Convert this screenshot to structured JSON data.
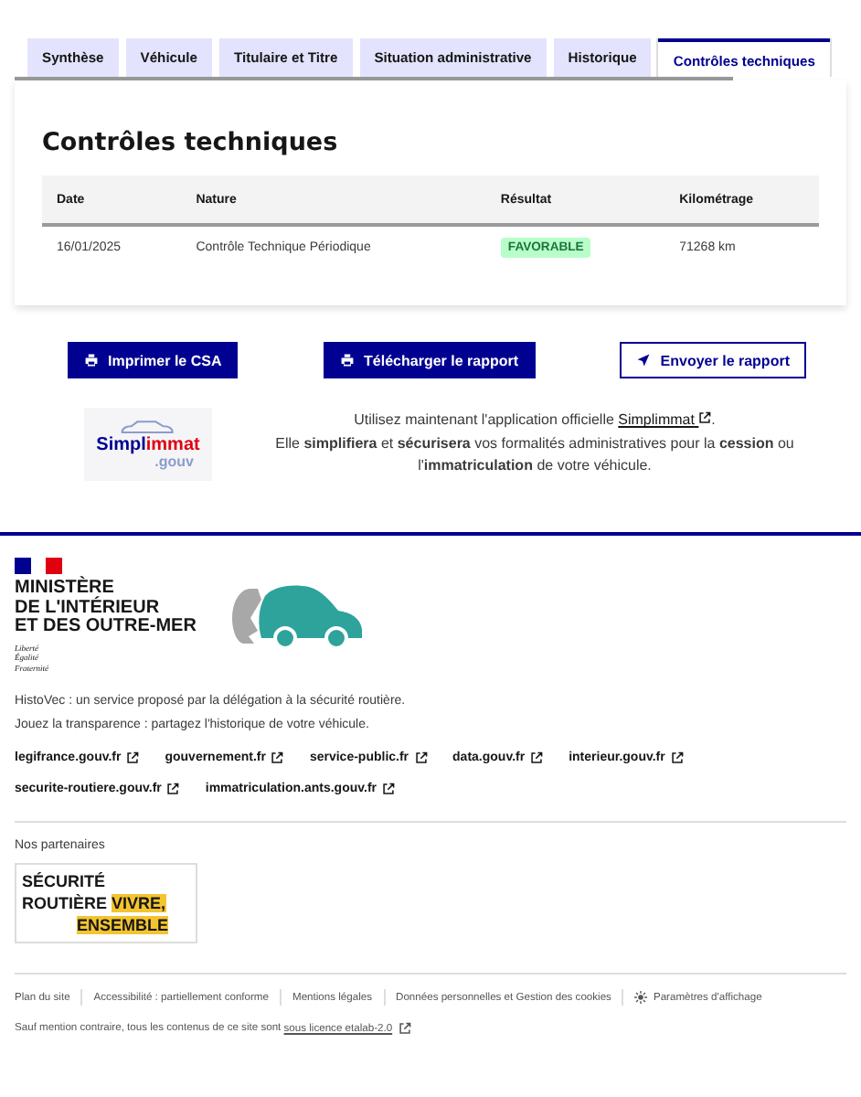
{
  "tabs": [
    {
      "label": "Synthèse",
      "selected": false
    },
    {
      "label": "Véhicule",
      "selected": false
    },
    {
      "label": "Titulaire et Titre",
      "selected": false
    },
    {
      "label": "Situation administrative",
      "selected": false
    },
    {
      "label": "Historique",
      "selected": false
    },
    {
      "label": "Contrôles techniques",
      "selected": true
    }
  ],
  "panel": {
    "title": "Contrôles techniques",
    "table": {
      "columns": [
        "Date",
        "Nature",
        "Résultat",
        "Kilométrage"
      ],
      "rows": [
        {
          "date": "16/01/2025",
          "nature": "Contrôle Technique Périodique",
          "result": {
            "text": "FAVORABLE",
            "kind": "success"
          },
          "mileage": "71268 km"
        }
      ]
    }
  },
  "buttons": [
    {
      "label": "Imprimer le CSA",
      "kind": "primary"
    },
    {
      "label": "Télécharger le rapport",
      "kind": "primary"
    },
    {
      "label": "Envoyer le rapport",
      "kind": "secondary"
    }
  ],
  "promo": {
    "logo": {
      "part_1": "Simpl",
      "part_2": "immat",
      "part_3": ".gouv"
    },
    "intro": "Utilisez maintenant l'application officielle",
    "link": "Simplimmat",
    "intro_end": ".",
    "body": "Elle **simplifiera** et **sécurisera** vos formalités administratives pour la **cession** ou l'**immatriculation** de votre véhicule."
  },
  "footer": {
    "ministry": [
      "MINISTÈRE",
      "DE L'INTÉRIEUR",
      "ET DES OUTRE-MER"
    ],
    "motto": [
      "Liberté",
      "Égalité",
      "Fraternité"
    ],
    "description": [
      "HistoVec : un service proposé par la délégation à la sécurité routière.",
      "Jouez la transparence : partagez l'historique de votre véhicule."
    ],
    "links": [
      "legifrance.gouv.fr",
      "gouvernement.fr",
      "service-public.fr",
      "data.gouv.fr",
      "interieur.gouv.fr",
      "securite-routiere.gouv.fr",
      "immatriculation.ants.gouv.fr"
    ],
    "partners_label": "Nos partenaires",
    "partner_logo": {
      "line_1": "SÉCURITÉ",
      "line_2": "ROUTIÈRE",
      "highlight_1": "VIVRE,",
      "highlight_2": "ENSEMBLE"
    },
    "bottom_links": [
      {
        "label": "Plan du site",
        "kind": "link"
      },
      {
        "label": "Accessibilité : partiellement conforme",
        "kind": "link"
      },
      {
        "label": "Mentions légales",
        "kind": "link"
      },
      {
        "label": "Données personnelles et Gestion des cookies",
        "kind": "link"
      },
      {
        "label": "Paramètres d'affichage",
        "kind": "settings"
      }
    ],
    "license": "Sauf mention contraire, tous les contenus de ce site sont",
    "license_link": "sous licence etalab-2.0"
  }
}
